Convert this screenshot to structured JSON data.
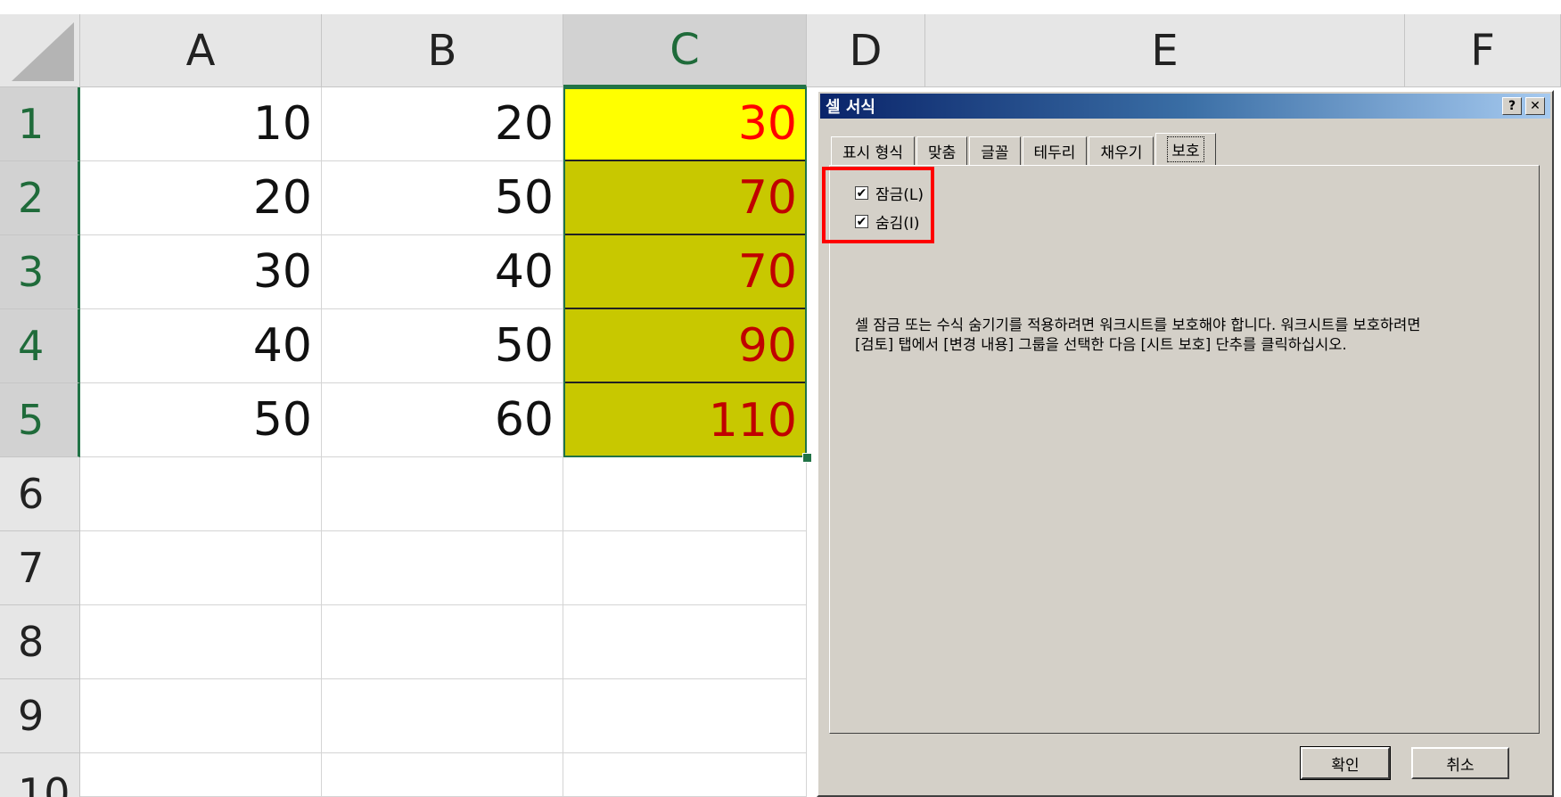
{
  "columns": [
    "A",
    "B",
    "C",
    "D",
    "E",
    "F"
  ],
  "rows": [
    "1",
    "2",
    "3",
    "4",
    "5",
    "6",
    "7",
    "8",
    "9",
    "10"
  ],
  "cells": {
    "A": [
      "10",
      "20",
      "30",
      "40",
      "50"
    ],
    "B": [
      "20",
      "50",
      "40",
      "50",
      "60"
    ],
    "C": [
      "30",
      "70",
      "70",
      "90",
      "110"
    ]
  },
  "colors": {
    "c1_fill": "#ffff00",
    "c2_5_fill": "#c8c800",
    "value_text_red": "#ff0000",
    "selection": "#217346",
    "highlight_box": "#ff0000"
  },
  "dialog": {
    "title": "셀 서식",
    "help_label": "?",
    "close_label": "✕",
    "tabs": [
      "표시 형식",
      "맞춤",
      "글꼴",
      "테두리",
      "채우기",
      "보호"
    ],
    "active_tab": "보호",
    "checkboxes": [
      {
        "label": "잠금(L)",
        "checked": true
      },
      {
        "label": "숨김(I)",
        "checked": true
      }
    ],
    "check_mark": "✔",
    "description_line1": "셀 잠금 또는 수식 숨기기를 적용하려면 워크시트를 보호해야 합니다. 워크시트를 보호하려면",
    "description_line2": "[검토] 탭에서 [변경 내용] 그룹을 선택한 다음 [시트 보호] 단추를 클릭하십시오.",
    "ok_label": "확인",
    "cancel_label": "취소"
  }
}
